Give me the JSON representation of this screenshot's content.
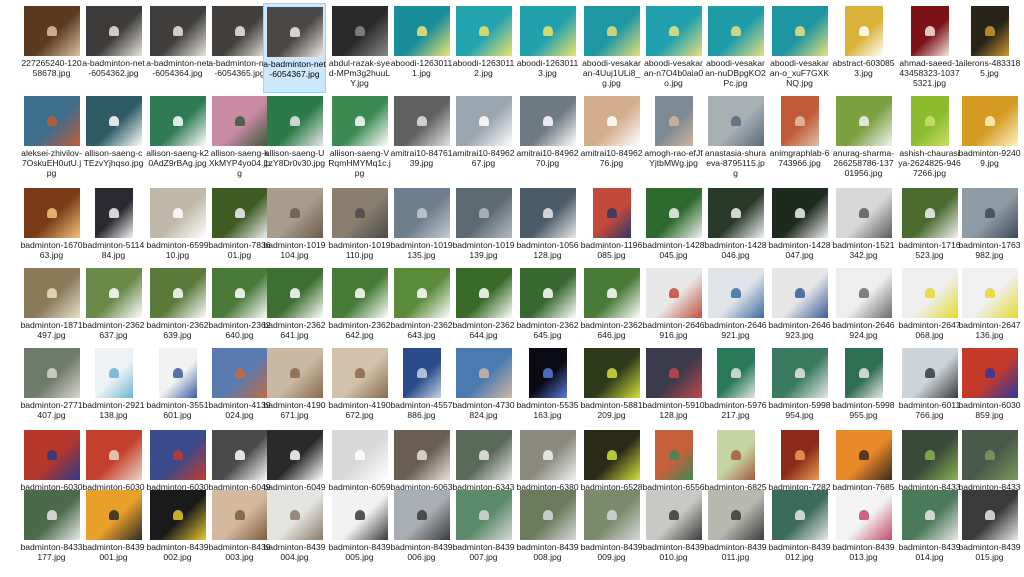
{
  "file_view": {
    "rows": [
      [
        {
          "name": "227265240-12058678.jpg",
          "color": "#5b3a22",
          "accent": "#d8c3a0"
        },
        {
          "name": "a-badminton-net-6054362.jpg",
          "color": "#3d3b3a",
          "accent": "#e9e6e0"
        },
        {
          "name": "a-badminton-net-6054364.jpg",
          "color": "#403e3d",
          "accent": "#e9e6e0"
        },
        {
          "name": "a-badminton-net-6054365.jpg",
          "color": "#423f3c",
          "accent": "#ebe8e2"
        },
        {
          "name": "a-badminton-net-6054367.jpg",
          "color": "#4a4744",
          "accent": "#eeeae4",
          "selected": true
        },
        {
          "name": "abdul-razak-syed-MPm3g2huuLY.jpg",
          "color": "#2a2a2a",
          "accent": "#8a8a8a"
        },
        {
          "name": "aboodi-12630111.jpg",
          "color": "#1a8d9a",
          "accent": "#f4e36a"
        },
        {
          "name": "aboodi-12630112.jpg",
          "color": "#22a3ad",
          "accent": "#f0e26a"
        },
        {
          "name": "aboodi-12630113.jpg",
          "color": "#21a0ab",
          "accent": "#f0e26a"
        },
        {
          "name": "aboodi-vesakaran-4Uuj1ULi8_g.jpg",
          "color": "#1e97a3",
          "accent": "#e8df72"
        },
        {
          "name": "aboodi-vesakaran-n7O4b0aia0o.jpg",
          "color": "#20a0ac",
          "accent": "#ece07a"
        },
        {
          "name": "aboodi-vesakaran-nuDBpgKO2Pc.jpg",
          "color": "#1f9ba8",
          "accent": "#ece07a"
        },
        {
          "name": "aboodi-vesakaran-o_xuF7GXKNQ.jpg",
          "color": "#1d94a0",
          "accent": "#ece07a"
        },
        {
          "name": "abstract-6030853.jpg",
          "color": "#d9b23a",
          "accent": "#ffffff",
          "portrait": true
        },
        {
          "name": "ahmad-saeed-143458323-10375321.jpg",
          "color": "#7a1218",
          "accent": "#f1e8e0",
          "portrait": true
        },
        {
          "name": "ailerons-4833185.jpg",
          "color": "#2a2418",
          "accent": "#c99b2a",
          "portrait": true
        }
      ],
      [
        {
          "name": "aleksei-zhivilov-7OskuEH0utU.jpg",
          "color": "#3d6e8a",
          "accent": "#c45a3a"
        },
        {
          "name": "allison-saeng-cTEzvYjhqso.jpg",
          "color": "#2e5b66",
          "accent": "#ffffff"
        },
        {
          "name": "allison-saeng-k20AdZ9rBAg.jpg",
          "color": "#2f7a55",
          "accent": "#ffffff"
        },
        {
          "name": "allison-saeng-kXkMYP4yo04.jpg",
          "color": "#c98aa4",
          "accent": "#3a5a3a"
        },
        {
          "name": "allison-saeng-U1zY8Dr0v30.jpg",
          "color": "#2b7a48",
          "accent": "#e6e6e6"
        },
        {
          "name": "allison-saeng-VRqmHMYMq1c.jpg",
          "color": "#3c8a52",
          "accent": "#ffffff"
        },
        {
          "name": "amitrai10-8476139.jpg",
          "color": "#606060",
          "accent": "#e2e2e2"
        },
        {
          "name": "amitrai10-8496267.jpg",
          "color": "#9aa6b0",
          "accent": "#ffffff"
        },
        {
          "name": "amitrai10-8496270.jpg",
          "color": "#6e7a82",
          "accent": "#ffffff"
        },
        {
          "name": "amitrai10-8496276.jpg",
          "color": "#d2ad8e",
          "accent": "#ffffff"
        },
        {
          "name": "amogh-rao-efJfYjtbMWg.jpg",
          "color": "#7d8a96",
          "accent": "#d4b49a",
          "portrait": true
        },
        {
          "name": "anastasia-shuraeva-8795115.jpg",
          "color": "#a8b0b4",
          "accent": "#5a6a7a"
        },
        {
          "name": "animgraphlab-6743966.jpg",
          "color": "#c15a3a",
          "accent": "#dcc4a8",
          "portrait": true
        },
        {
          "name": "anurag-sharma-266258786-13701956.jpg",
          "color": "#7aa040",
          "accent": "#f2f2f2"
        },
        {
          "name": "ashish-chaurasiya-2624825-9467266.jpg",
          "color": "#8dbb2e",
          "accent": "#c9e06a",
          "portrait": true
        },
        {
          "name": "badminton-92409.jpg",
          "color": "#d49a22",
          "accent": "#fff3c4"
        }
      ],
      [
        {
          "name": "badminton-167063.jpg",
          "color": "#7a3c18",
          "accent": "#f3c27a"
        },
        {
          "name": "badminton-511484.jpg",
          "color": "#2a2a30",
          "accent": "#f4f4f4",
          "portrait": true
        },
        {
          "name": "badminton-659910.jpg",
          "color": "#bfb8a8",
          "accent": "#ffffff"
        },
        {
          "name": "badminton-783601.jpg",
          "color": "#3d5a22",
          "accent": "#f2f2f2"
        },
        {
          "name": "badminton-1019104.jpg",
          "color": "#a89c8c",
          "accent": "#6a5a4a"
        },
        {
          "name": "badminton-1019110.jpg",
          "color": "#8a7e6e",
          "accent": "#4a4a4a"
        },
        {
          "name": "badminton-1019135.jpg",
          "color": "#6e7e8c",
          "accent": "#c4ccd2"
        },
        {
          "name": "badminton-1019139.jpg",
          "color": "#5e6a72",
          "accent": "#b4bcc2"
        },
        {
          "name": "badminton-1056128.jpg",
          "color": "#4a5a66",
          "accent": "#e8e8e8"
        },
        {
          "name": "badminton-1196085.jpg",
          "color": "#c34a3a",
          "accent": "#2a3a6a",
          "portrait": true
        },
        {
          "name": "badminton-1428045.jpg",
          "color": "#2e6a2e",
          "accent": "#f2f2f2"
        },
        {
          "name": "badminton-1428046.jpg",
          "color": "#2a3a2a",
          "accent": "#f2f2f2"
        },
        {
          "name": "badminton-1428047.jpg",
          "color": "#1e2a1e",
          "accent": "#f2f2f2"
        },
        {
          "name": "badminton-1521342.jpg",
          "color": "#d8d8d8",
          "accent": "#5a5a5a"
        },
        {
          "name": "badminton-1716523.jpg",
          "color": "#4a6a2e",
          "accent": "#f2f2f2"
        },
        {
          "name": "badminton-1763982.jpg",
          "color": "#8e9aa4",
          "accent": "#3a4a5a"
        }
      ],
      [
        {
          "name": "badminton-1871497.jpg",
          "color": "#8a7a5a",
          "accent": "#e8e0c8"
        },
        {
          "name": "badminton-2362637.jpg",
          "color": "#6a8a4a",
          "accent": "#ffffff"
        },
        {
          "name": "badminton-2362639.jpg",
          "color": "#5a7a3a",
          "accent": "#ffffff"
        },
        {
          "name": "badminton-2362640.jpg",
          "color": "#4a7a3a",
          "accent": "#ffffff"
        },
        {
          "name": "badminton-2362641.jpg",
          "color": "#3e6e32",
          "accent": "#ffffff"
        },
        {
          "name": "badminton-2362642.jpg",
          "color": "#467a36",
          "accent": "#ffffff"
        },
        {
          "name": "badminton-2362643.jpg",
          "color": "#5a8a3a",
          "accent": "#ffffff"
        },
        {
          "name": "badminton-2362644.jpg",
          "color": "#3a6a2a",
          "accent": "#ffffff"
        },
        {
          "name": "badminton-2362645.jpg",
          "color": "#386830",
          "accent": "#ffffff"
        },
        {
          "name": "badminton-2362646.jpg",
          "color": "#4a7a38",
          "accent": "#ffffff"
        },
        {
          "name": "badminton-2646916.jpg",
          "color": "#e8e8e8",
          "accent": "#c44a3a"
        },
        {
          "name": "badminton-2646921.jpg",
          "color": "#e0e4e8",
          "accent": "#3a6aa4"
        },
        {
          "name": "badminton-2646923.jpg",
          "color": "#e6e6e6",
          "accent": "#3a5a9a"
        },
        {
          "name": "badminton-2646924.jpg",
          "color": "#eeeeee",
          "accent": "#6a6a6a"
        },
        {
          "name": "badminton-2647068.jpg",
          "color": "#efefef",
          "accent": "#e6d82a"
        },
        {
          "name": "badminton-2647136.jpg",
          "color": "#f0f0f0",
          "accent": "#e6d82a"
        }
      ],
      [
        {
          "name": "badminton-2771407.jpg",
          "color": "#6e7a6a",
          "accent": "#d8d8d0"
        },
        {
          "name": "badminton-2921138.jpg",
          "color": "#eef2f4",
          "accent": "#6ab4d4",
          "portrait": true
        },
        {
          "name": "badminton-3551601.jpg",
          "color": "#f2f2f2",
          "accent": "#3a5aa4",
          "portrait": true
        },
        {
          "name": "badminton-4139024.jpg",
          "color": "#5a7ab0",
          "accent": "#c46a3a"
        },
        {
          "name": "badminton-4190671.jpg",
          "color": "#c8b8a4",
          "accent": "#8a6a4a"
        },
        {
          "name": "badminton-4190672.jpg",
          "color": "#d2c2ac",
          "accent": "#8a6a4a"
        },
        {
          "name": "badminton-4557886.jpg",
          "color": "#2a4a8a",
          "accent": "#c4d4e4",
          "portrait": true
        },
        {
          "name": "badminton-4730824.jpg",
          "color": "#4a7ab0",
          "accent": "#d0b8a0"
        },
        {
          "name": "badminton-5535163.jpg",
          "color": "#0a0a14",
          "accent": "#5a7ae4",
          "portrait": true
        },
        {
          "name": "badminton-5881209.jpg",
          "color": "#2e3a1a",
          "accent": "#d4e23a"
        },
        {
          "name": "badminton-5910128.jpg",
          "color": "#3a3a4a",
          "accent": "#c44a4a"
        },
        {
          "name": "badminton-5976217.jpg",
          "color": "#2a7a5a",
          "accent": "#e4e4e4",
          "portrait": true
        },
        {
          "name": "badminton-5998954.jpg",
          "color": "#3a7a5e",
          "accent": "#e8e8e8"
        },
        {
          "name": "badminton-5998955.jpg",
          "color": "#2e6e52",
          "accent": "#e8e8e8",
          "portrait": true
        },
        {
          "name": "badminton-6011766.jpg",
          "color": "#ccd4da",
          "accent": "#3a3a3a"
        },
        {
          "name": "badminton-6030859.jpg",
          "color": "#c43a2a",
          "accent": "#2a3aa4"
        }
      ],
      [
        {
          "name": "badminton-6030860.jpg",
          "color": "#b4382a",
          "accent": "#2a3a8a"
        },
        {
          "name": "badminton-6030861.jpg",
          "color": "#c4402e",
          "accent": "#e8d8c4"
        },
        {
          "name": "badminton-6030862.jpg",
          "color": "#3a4a8a",
          "accent": "#c43a2a"
        },
        {
          "name": "badminton-6049359.jpg",
          "color": "#4a4a4a",
          "accent": "#ffffff"
        },
        {
          "name": "badminton-6049362.jpg",
          "color": "#2a2a2a",
          "accent": "#ffffff"
        },
        {
          "name": "badminton-6059525.jpg",
          "color": "#d8d8d8",
          "accent": "#ffffff"
        },
        {
          "name": "badminton-6063628.jpg",
          "color": "#6a5e52",
          "accent": "#e8e0d8"
        },
        {
          "name": "badminton-6343758.jpg",
          "color": "#5a6a5a",
          "accent": "#e8e8e8"
        },
        {
          "name": "badminton-6380226.jpg",
          "color": "#8a8a7e",
          "accent": "#f2f2f2"
        },
        {
          "name": "badminton-6528227.jpg",
          "color": "#2a2a18",
          "accent": "#d4e23a"
        },
        {
          "name": "badminton-6556437.jpg",
          "color": "#c4603a",
          "accent": "#3a8a5a",
          "portrait": true
        },
        {
          "name": "badminton-6825695.jpg",
          "color": "#c4d4a4",
          "accent": "#a45a3a",
          "portrait": true
        },
        {
          "name": "badminton-7282576.jpg",
          "color": "#8a2a1a",
          "accent": "#e8a050",
          "portrait": true
        },
        {
          "name": "badminton-7685243.jpg",
          "color": "#e88a2a",
          "accent": "#3a2a1a"
        },
        {
          "name": "badminton-8433175.jpg",
          "color": "#3a4a3a",
          "accent": "#8ab450"
        },
        {
          "name": "badminton-8433176.jpg",
          "color": "#4a5a4a",
          "accent": "#7a9a5a"
        }
      ],
      [
        {
          "name": "badminton-8433177.jpg",
          "color": "#4a6a4a",
          "accent": "#e8e8e8"
        },
        {
          "name": "badminton-8439001.jpg",
          "color": "#e8a02a",
          "accent": "#2a2a2a"
        },
        {
          "name": "badminton-8439002.jpg",
          "color": "#1a1a1a",
          "accent": "#e8c82a"
        },
        {
          "name": "badminton-8439003.jpg",
          "color": "#d4b8a0",
          "accent": "#7a5a3a"
        },
        {
          "name": "badminton-8439004.jpg",
          "color": "#e4e4e0",
          "accent": "#8a7a6a"
        },
        {
          "name": "badminton-8439005.jpg",
          "color": "#f2f2f2",
          "accent": "#3a3a3a"
        },
        {
          "name": "badminton-8439006.jpg",
          "color": "#a8aeb4",
          "accent": "#3a3a3a"
        },
        {
          "name": "badminton-8439007.jpg",
          "color": "#5a8a6a",
          "accent": "#d8d8d8"
        },
        {
          "name": "badminton-8439008.jpg",
          "color": "#6a7a5a",
          "accent": "#d8d8d8"
        },
        {
          "name": "badminton-8439009.jpg",
          "color": "#7a8a6a",
          "accent": "#d8d8d8"
        },
        {
          "name": "badminton-8439010.jpg",
          "color": "#c8c8c4",
          "accent": "#3a3a3a"
        },
        {
          "name": "badminton-8439011.jpg",
          "color": "#b8b8b0",
          "accent": "#3a3a3a"
        },
        {
          "name": "badminton-8439012.jpg",
          "color": "#3a6a5a",
          "accent": "#e8e8e8"
        },
        {
          "name": "badminton-8439013.jpg",
          "color": "#f4f4f4",
          "accent": "#c44a6a"
        },
        {
          "name": "badminton-8439014.jpg",
          "color": "#4a7a5a",
          "accent": "#e8e8e8"
        },
        {
          "name": "badminton-8439015.jpg",
          "color": "#3a3a3a",
          "accent": "#e8e8e8"
        }
      ]
    ]
  }
}
